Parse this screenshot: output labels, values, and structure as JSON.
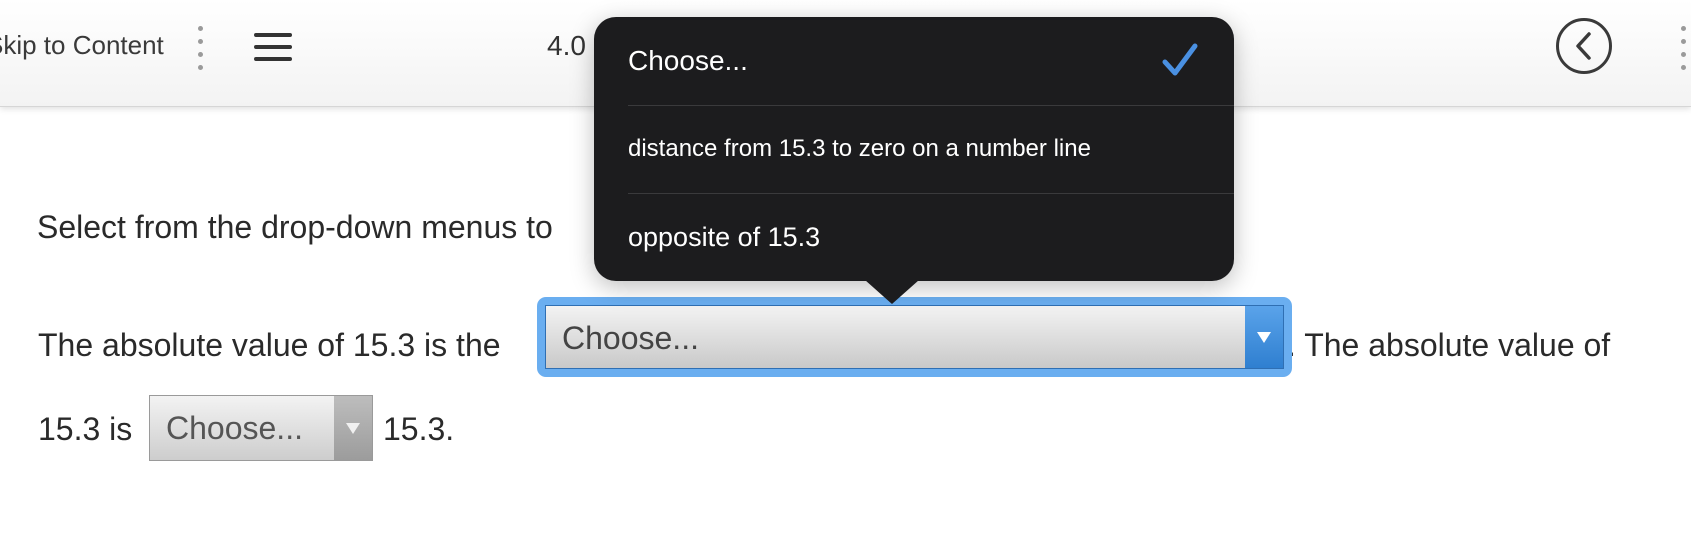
{
  "topbar": {
    "skip_link": "Skip to Content",
    "lesson_title": "4.0",
    "menu_icon": "hamburger-menu-icon",
    "back_icon": "chevron-left-circle-icon"
  },
  "question": {
    "prompt": "Select from the drop-down menus to",
    "line1_before": "The absolute value of 15.3 is the",
    "line1_after": ". The absolute value of",
    "line2_before": "15.3 is",
    "line2_after": "15.3."
  },
  "select1": {
    "value": "Choose...",
    "focused": true
  },
  "select2": {
    "value": "Choose..."
  },
  "popover": {
    "options": [
      {
        "label": "Choose...",
        "selected": true
      },
      {
        "label": "distance from 15.3 to zero on a number line",
        "selected": false
      },
      {
        "label": "opposite of 15.3",
        "selected": false
      }
    ]
  },
  "colors": {
    "accent": "#4a90e2",
    "popover_bg": "#1c1c1e",
    "focus_ring": "#6aaef0"
  }
}
